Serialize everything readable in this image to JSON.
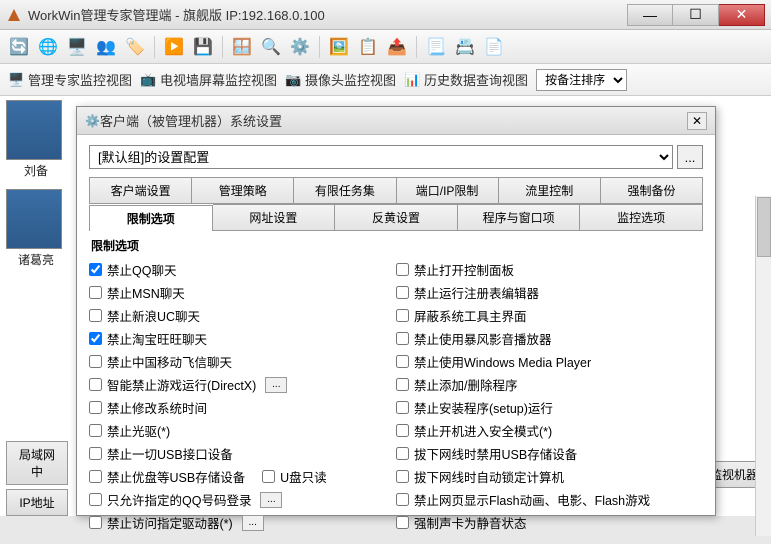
{
  "titlebar": {
    "text": "WorkWin管理专家管理端 - 旗舰版 IP:192.168.0.100"
  },
  "views": {
    "monitor": "管理专家监控视图",
    "wall": "电视墙屏幕监控视图",
    "camera": "摄像头监控视图",
    "history": "历史数据查询视图",
    "sort": "按备注排序"
  },
  "thumbs": {
    "t1": "刘备",
    "t2": "诸葛亮"
  },
  "bottom": {
    "lan": "局域网中",
    "ip": "IP地址",
    "right": "监视机器"
  },
  "dialog": {
    "title": "客户端（被管理机器）系统设置",
    "config": "[默认组]的设置配置",
    "tabs1": {
      "t0": "客户端设置",
      "t1": "管理策略",
      "t2": "有限任务集",
      "t3": "端口/IP限制",
      "t4": "流里控制",
      "t5": "强制备份"
    },
    "tabs2": {
      "t0": "限制选项",
      "t1": "网址设置",
      "t2": "反黄设置",
      "t3": "程序与窗口项",
      "t4": "监控选项"
    },
    "group": "限制选项",
    "left": {
      "o0": "禁止QQ聊天",
      "o1": "禁止MSN聊天",
      "o2": "禁止新浪UC聊天",
      "o3": "禁止淘宝旺旺聊天",
      "o4": "禁止中国移动飞信聊天",
      "o5": "智能禁止游戏运行(DirectX)",
      "o6": "禁止修改系统时间",
      "o7": "禁止光驱(*)",
      "o8": "禁止一切USB接口设备",
      "o9": "禁止优盘等USB存储设备",
      "o9b": "U盘只读",
      "o10": "只允许指定的QQ号码登录",
      "o11": "禁止访问指定驱动器(*)"
    },
    "right": {
      "o0": "禁止打开控制面板",
      "o1": "禁止运行注册表编辑器",
      "o2": "屏蔽系统工具主界面",
      "o3": "禁止使用暴风影音播放器",
      "o4": "禁止使用Windows Media Player",
      "o5": "禁止添加/删除程序",
      "o6": "禁止安装程序(setup)运行",
      "o7": "禁止开机进入安全模式(*)",
      "o8": "拔下网线时禁用USB存储设备",
      "o9": "拔下网线时自动锁定计算机",
      "o10": "禁止网页显示Flash动画、电影、Flash游戏",
      "o11": "强制声卡为静音状态"
    }
  }
}
